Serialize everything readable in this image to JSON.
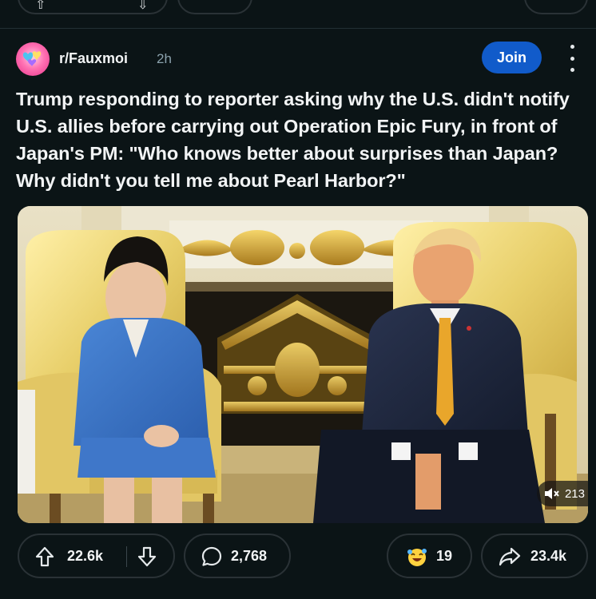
{
  "post": {
    "subreddit": "r/Fauxmoi",
    "time": "2h",
    "join_label": "Join",
    "title": "Trump responding to reporter asking why the U.S. didn't notify U.S. allies before carrying out Operation Epic Fury, in front of Japan's PM: \"Who knows better about surprises than Japan? Why didn't you tell me about Pearl Harbor?\""
  },
  "media": {
    "badge_count": "213"
  },
  "actions": {
    "upvotes": "22.6k",
    "comments": "2,768",
    "awards": "19",
    "shares": "23.4k"
  },
  "icons": {
    "avatar": "subreddit-avatar",
    "more": "more-vertical-icon",
    "upvote": "upvote-arrow-icon",
    "downvote": "downvote-arrow-icon",
    "comment": "comment-bubble-icon",
    "award": "award-emoji-icon",
    "share": "share-arrow-icon",
    "audio": "audio-muted-icon"
  },
  "colors": {
    "background": "#0b1416",
    "join_button": "#115bca",
    "pill_border": "#2a3236",
    "muted_text": "#8ba2ad"
  }
}
